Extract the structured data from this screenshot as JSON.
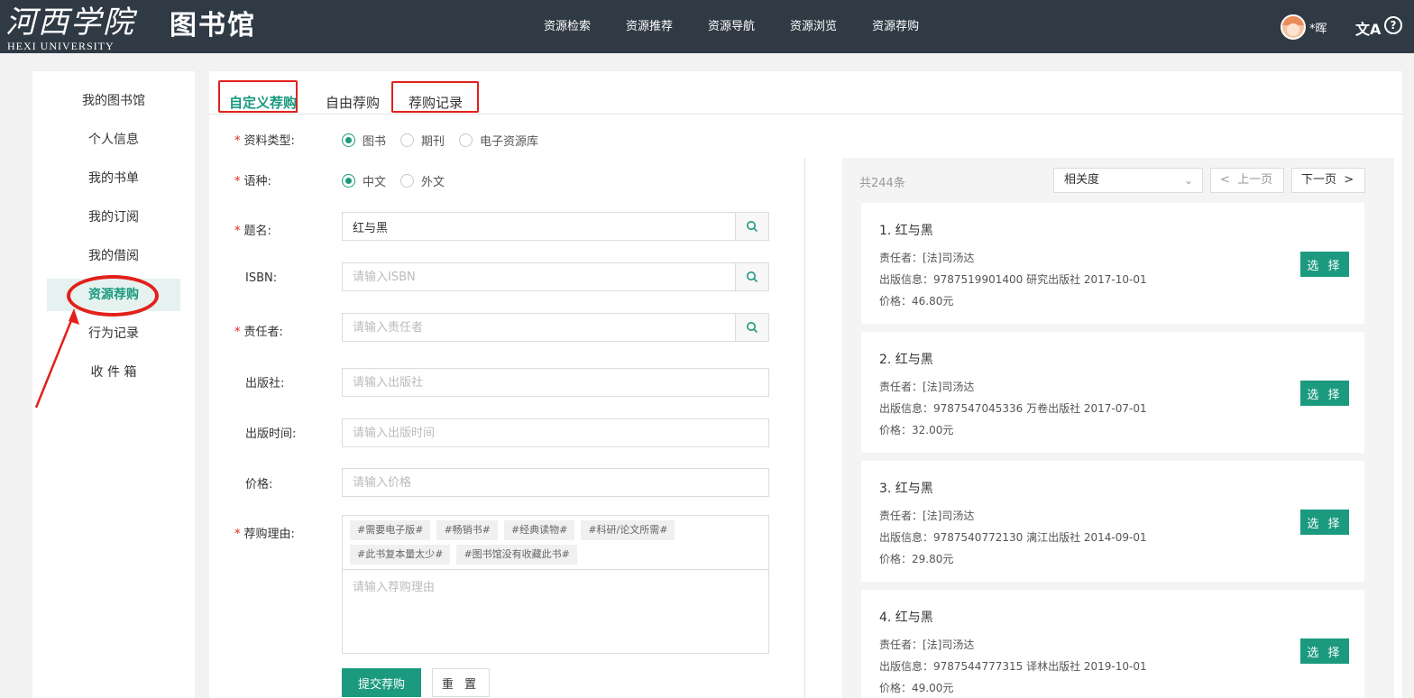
{
  "header": {
    "logo_script": "河西学院",
    "logo_en": "HEXI UNIVERSITY",
    "site_title": "图书馆",
    "nav": [
      "资源检索",
      "资源推荐",
      "资源导航",
      "资源浏览",
      "资源荐购"
    ],
    "user": "*晖",
    "translate_icon_text": "文A",
    "help_icon_text": "?"
  },
  "sidebar": {
    "items": [
      "我的图书馆",
      "个人信息",
      "我的书单",
      "我的订阅",
      "我的借阅",
      "资源荐购",
      "行为记录",
      "收 件 箱"
    ],
    "active_index": 5
  },
  "tabs": [
    "自定义荐购",
    "自由荐购",
    "荐购记录"
  ],
  "form": {
    "type_label": "资料类型:",
    "type_options": [
      "图书",
      "期刊",
      "电子资源库"
    ],
    "lang_label": "语种:",
    "lang_options": [
      "中文",
      "外文"
    ],
    "title_label": "题名:",
    "title_value": "红与黑",
    "isbn_label": "ISBN:",
    "isbn_placeholder": "请输入ISBN",
    "author_label": "责任者:",
    "author_placeholder": "请输入责任者",
    "publisher_label": "出版社:",
    "publisher_placeholder": "请输入出版社",
    "pubdate_label": "出版时间:",
    "pubdate_placeholder": "请输入出版时间",
    "price_label": "价格:",
    "price_placeholder": "请输入价格",
    "reason_label": "荐购理由:",
    "reason_tags": [
      "#需要电子版#",
      "#畅销书#",
      "#经典读物#",
      "#科研/论文所需#",
      "#此书复本量太少#",
      "#图书馆没有收藏此书#"
    ],
    "reason_placeholder": "请输入荐购理由",
    "submit_label": "提交荐购",
    "reset_label": "重 置"
  },
  "results": {
    "total": "共244条",
    "sort_value": "相关度",
    "prev_label": "上一页",
    "next_label": "下一页",
    "items": [
      {
        "title": "1. 红与黑",
        "author": "责任者：[法]司汤达",
        "pub": "出版信息：9787519901400  研究出版社  2017-10-01",
        "price": "价格：46.80元",
        "btn": "选 择"
      },
      {
        "title": "2. 红与黑",
        "author": "责任者：[法]司汤达",
        "pub": "出版信息：9787547045336  万卷出版社  2017-07-01",
        "price": "价格：32.00元",
        "btn": "选 择"
      },
      {
        "title": "3. 红与黑",
        "author": "责任者：[法]司汤达",
        "pub": "出版信息：9787540772130  漓江出版社  2014-09-01",
        "price": "价格：29.80元",
        "btn": "选 择"
      },
      {
        "title": "4. 红与黑",
        "author": "责任者：[法]司汤达",
        "pub": "出版信息：9787544777315  译林出版社  2019-10-01",
        "price": "价格：49.00元",
        "btn": "选 择"
      }
    ]
  },
  "colors": {
    "accent": "#1b9a7f",
    "header_bg": "#2f3a45",
    "annotation_red": "#e3201b"
  }
}
